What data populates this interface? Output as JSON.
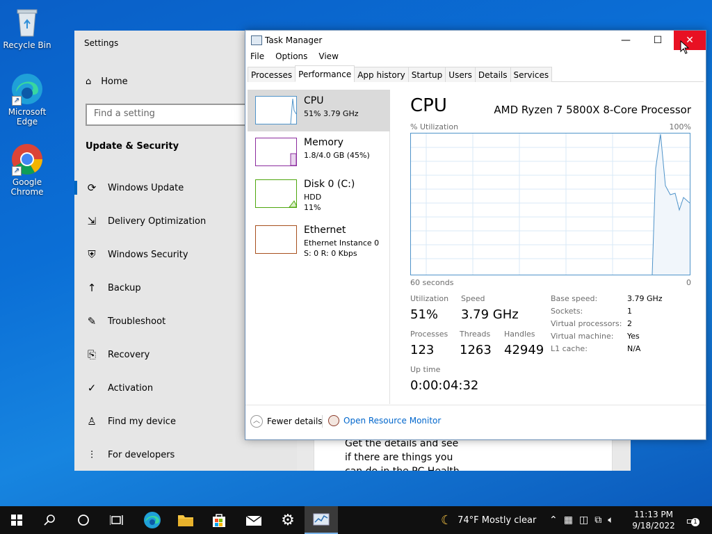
{
  "desktop": {
    "icons": [
      {
        "label": "Recycle Bin"
      },
      {
        "label": "Microsoft Edge"
      },
      {
        "label": "Google Chrome"
      }
    ]
  },
  "settings": {
    "title": "Settings",
    "home": "Home",
    "search_placeholder": "Find a setting",
    "section": "Update & Security",
    "nav": [
      {
        "label": "Windows Update",
        "icon": "refresh-icon"
      },
      {
        "label": "Delivery Optimization",
        "icon": "delivery-icon"
      },
      {
        "label": "Windows Security",
        "icon": "shield-icon"
      },
      {
        "label": "Backup",
        "icon": "backup-icon"
      },
      {
        "label": "Troubleshoot",
        "icon": "wrench-icon"
      },
      {
        "label": "Recovery",
        "icon": "recovery-icon"
      },
      {
        "label": "Activation",
        "icon": "check-circle-icon"
      },
      {
        "label": "Find my device",
        "icon": "person-icon"
      },
      {
        "label": "For developers",
        "icon": "dev-icon"
      }
    ],
    "card_text": [
      "Get the details and see",
      "if there are things you",
      "can do in the PC Health"
    ]
  },
  "taskmanager": {
    "title": "Task Manager",
    "menu": [
      "File",
      "Options",
      "View"
    ],
    "tabs": [
      "Processes",
      "Performance",
      "App history",
      "Startup",
      "Users",
      "Details",
      "Services"
    ],
    "resources": [
      {
        "name": "CPU",
        "sub1": "51%  3.79 GHz",
        "sub2": ""
      },
      {
        "name": "Memory",
        "sub1": "1.8/4.0 GB (45%)",
        "sub2": ""
      },
      {
        "name": "Disk 0 (C:)",
        "sub1": "HDD",
        "sub2": "11%"
      },
      {
        "name": "Ethernet",
        "sub1": "Ethernet Instance 0",
        "sub2": "S: 0 R: 0 Kbps"
      }
    ],
    "cpu": {
      "heading": "CPU",
      "processor": "AMD Ryzen 7 5800X 8-Core Processor",
      "util_label": "% Utilization",
      "max_label": "100%",
      "time_label": "60 seconds",
      "zero_label": "0",
      "utilization_label": "Utilization",
      "utilization": "51%",
      "speed_label": "Speed",
      "speed": "3.79 GHz",
      "processes_label": "Processes",
      "processes": "123",
      "threads_label": "Threads",
      "threads": "1263",
      "handles_label": "Handles",
      "handles": "42949",
      "uptime_label": "Up time",
      "uptime": "0:00:04:32",
      "details": [
        {
          "k": "Base speed:",
          "v": "3.79 GHz"
        },
        {
          "k": "Sockets:",
          "v": "1"
        },
        {
          "k": "Virtual processors:",
          "v": "2"
        },
        {
          "k": "Virtual machine:",
          "v": "Yes"
        },
        {
          "k": "L1 cache:",
          "v": "N/A"
        }
      ]
    },
    "footer": {
      "fewer": "Fewer details",
      "monitor": "Open Resource Monitor"
    }
  },
  "taskbar": {
    "weather": "74°F  Mostly clear",
    "time": "11:13 PM",
    "date": "9/18/2022",
    "notifications": "1"
  }
}
